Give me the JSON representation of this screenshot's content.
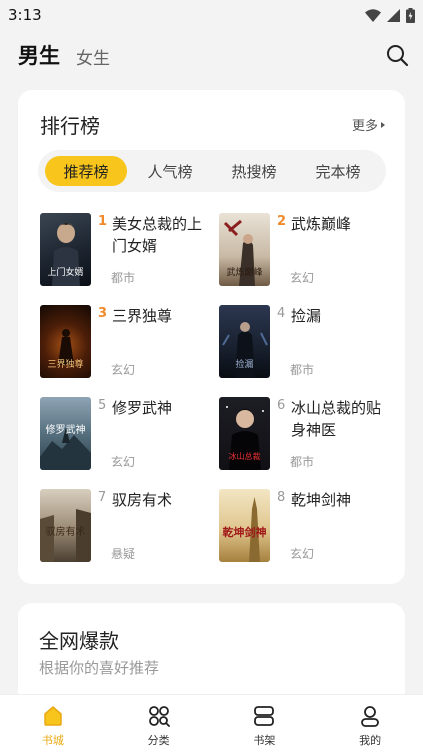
{
  "status": {
    "time": "3:13"
  },
  "top_tabs": {
    "male": "男生",
    "female": "女生"
  },
  "ranking": {
    "title": "排行榜",
    "more": "更多",
    "tabs": [
      "推荐榜",
      "人气榜",
      "热搜榜",
      "完本榜"
    ],
    "books": [
      {
        "rank": "1",
        "title": "美女总裁的上门女婿",
        "category": "都市",
        "cover_text": "上门女婿"
      },
      {
        "rank": "2",
        "title": "武炼巅峰",
        "category": "玄幻",
        "cover_text": "武炼巅峰"
      },
      {
        "rank": "3",
        "title": "三界独尊",
        "category": "玄幻",
        "cover_text": "三界独尊"
      },
      {
        "rank": "4",
        "title": "捡漏",
        "category": "都市",
        "cover_text": "捡漏"
      },
      {
        "rank": "5",
        "title": "修罗武神",
        "category": "玄幻",
        "cover_text": "修罗武神"
      },
      {
        "rank": "6",
        "title": "冰山总裁的贴身神医",
        "category": "都市",
        "cover_text": "冰山总裁"
      },
      {
        "rank": "7",
        "title": "驭房有术",
        "category": "悬疑",
        "cover_text": "驭房有术"
      },
      {
        "rank": "8",
        "title": "乾坤剑神",
        "category": "玄幻",
        "cover_text": "乾坤剑神"
      }
    ]
  },
  "hot": {
    "title": "全网爆款",
    "subtitle": "根据你的喜好推荐"
  },
  "bottom_nav": {
    "items": [
      "书城",
      "分类",
      "书架",
      "我的"
    ],
    "active_color": "#e8a913"
  },
  "colors": {
    "accent": "#f7c51c",
    "rank_top": "#f08a2c"
  }
}
